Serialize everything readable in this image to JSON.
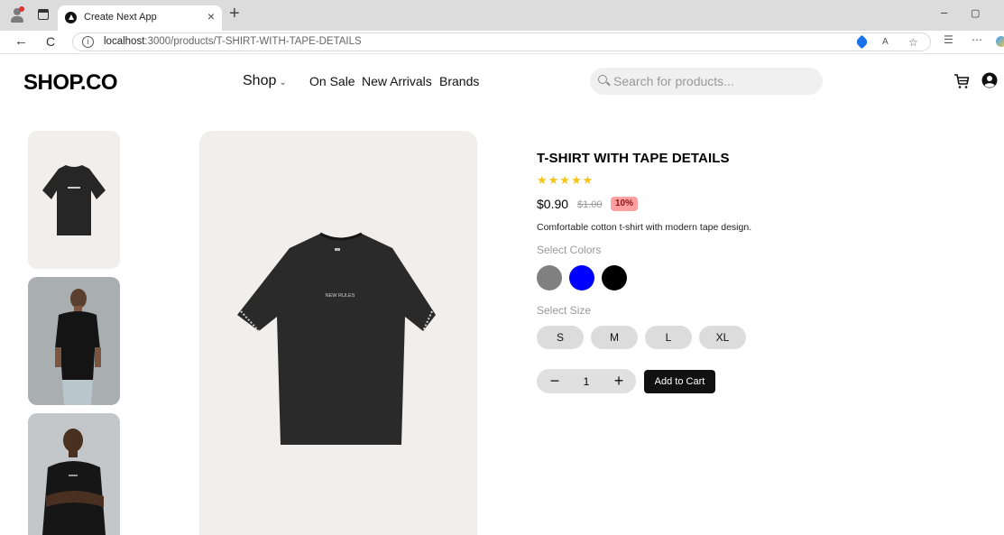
{
  "browser": {
    "tab_title": "Create Next App",
    "tab_close": "×",
    "new_tab": "+",
    "url_host": "localhost",
    "url_path": ":3000/products/T-SHIRT-WITH-TAPE-DETAILS",
    "back": "←",
    "reload": "C",
    "info": "i",
    "window": {
      "minimize": "–",
      "restore": "▢"
    }
  },
  "header": {
    "logo": "SHOP.CO",
    "nav": {
      "shop": "Shop",
      "shop_chevron": "⌄",
      "on_sale": "On Sale",
      "new_arrivals": "New Arrivals",
      "brands": "Brands"
    },
    "search": {
      "placeholder": "Search for products...",
      "value": ""
    }
  },
  "product": {
    "title": "T-SHIRT WITH TAPE DETAILS",
    "rating": 5,
    "stars": "★★★★★",
    "price": "$0.90",
    "old_price": "$1.00",
    "discount": "10%",
    "description": "Comfortable cotton t-shirt with modern tape design.",
    "colors_label": "Select Colors",
    "colors": [
      "#808080",
      "#0000ff",
      "#000000"
    ],
    "size_label": "Select Size",
    "sizes": [
      "S",
      "M",
      "L",
      "XL"
    ],
    "quantity": "1",
    "qty_minus": "−",
    "qty_plus": "+",
    "add_to_cart": "Add to Cart",
    "shirt_print": "NEW RULES"
  },
  "colors": {
    "star": "#f5c518",
    "discount_bg": "#ff9f9f",
    "button_dark": "#111111",
    "pill_bg": "#dcdcdc"
  }
}
